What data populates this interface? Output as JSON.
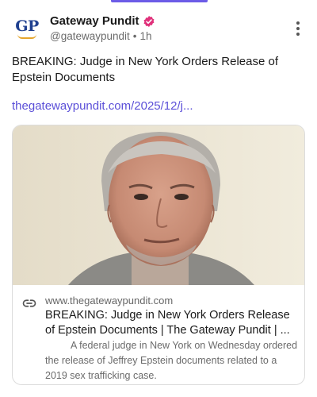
{
  "author": {
    "avatar_text": "GP",
    "display_name": "Gateway Pundit",
    "handle": "@gatewaypundit",
    "time": "1h",
    "verified_color": "#e0307a"
  },
  "post": {
    "text": "BREAKING: Judge in New York Orders Release of Epstein Documents",
    "link_text": "thegatewaypundit.com/2025/12/j..."
  },
  "card": {
    "image_alt": "photo of a gray-haired man against a pale background",
    "domain": "www.thegatewaypundit.com",
    "title": "BREAKING: Judge in New York Orders Release of Epstein Documents | The Gateway Pundit | ...",
    "description": "A federal judge in New York on Wednesday ordered the release of Jeffrey Epstein documents related to a 2019 sex trafficking case."
  },
  "icons": {
    "more": "more-vertical-icon",
    "verified": "verified-badge-icon",
    "link": "link-icon"
  },
  "colors": {
    "accent": "#6c5ce7",
    "link": "#5b4fd8",
    "brand_blue": "#1f3f8f",
    "brand_gold": "#e5a52b"
  }
}
